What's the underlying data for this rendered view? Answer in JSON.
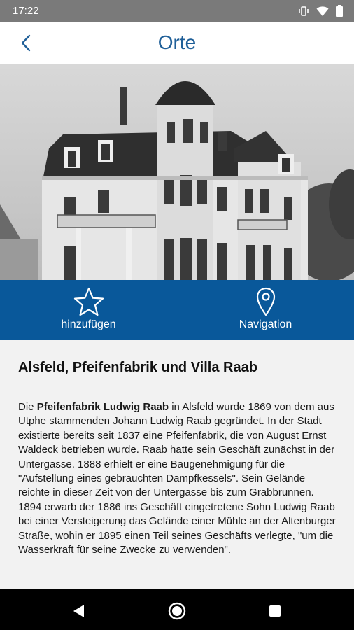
{
  "status_bar": {
    "time": "17:22",
    "icons": [
      "vibrate-icon",
      "wifi-icon",
      "battery-icon"
    ]
  },
  "app_bar": {
    "title": "Orte",
    "back_icon": "chevron-left-icon"
  },
  "hero": {
    "description_icon": "photo",
    "slides_indicator_active": 1
  },
  "actions": {
    "favorite": {
      "label": "hinzufügen",
      "icon": "star-outline-icon"
    },
    "navigation": {
      "label": "Navigation",
      "icon": "location-pin-icon"
    }
  },
  "article": {
    "title": "Alsfeld, Pfeifenfabrik und Villa Raab",
    "body_prefix": "Die ",
    "body_bold": "Pfeifenfabrik Ludwig Raab",
    "body_text": " in Alsfeld wurde 1869 von dem aus Utphe stammenden Johann Ludwig Raab gegründet. In der Stadt existierte bereits seit 1837 eine Pfeifenfabrik, die von August Ernst Waldeck betrieben wurde. Raab hatte sein Geschäft zunächst in der Untergasse. 1888 erhielt er eine Baugenehmigung für die \"Aufstellung eines gebrauchten Dampfkessels\". Sein Gelände reichte in dieser Zeit von der Untergasse bis zum Grabbrunnen. 1894 erwarb der 1886 ins Geschäft eingetretene Sohn Ludwig Raab bei einer Versteigerung das Gelände einer Mühle an der Altenburger Straße, wohin er 1895 einen Teil seines Geschäfts verlegte, \"um die Wasserkraft für seine Zwecke zu verwenden\"."
  },
  "colors": {
    "accent": "#09589a",
    "title": "#1f5f98",
    "status": "#7a7a7a"
  }
}
